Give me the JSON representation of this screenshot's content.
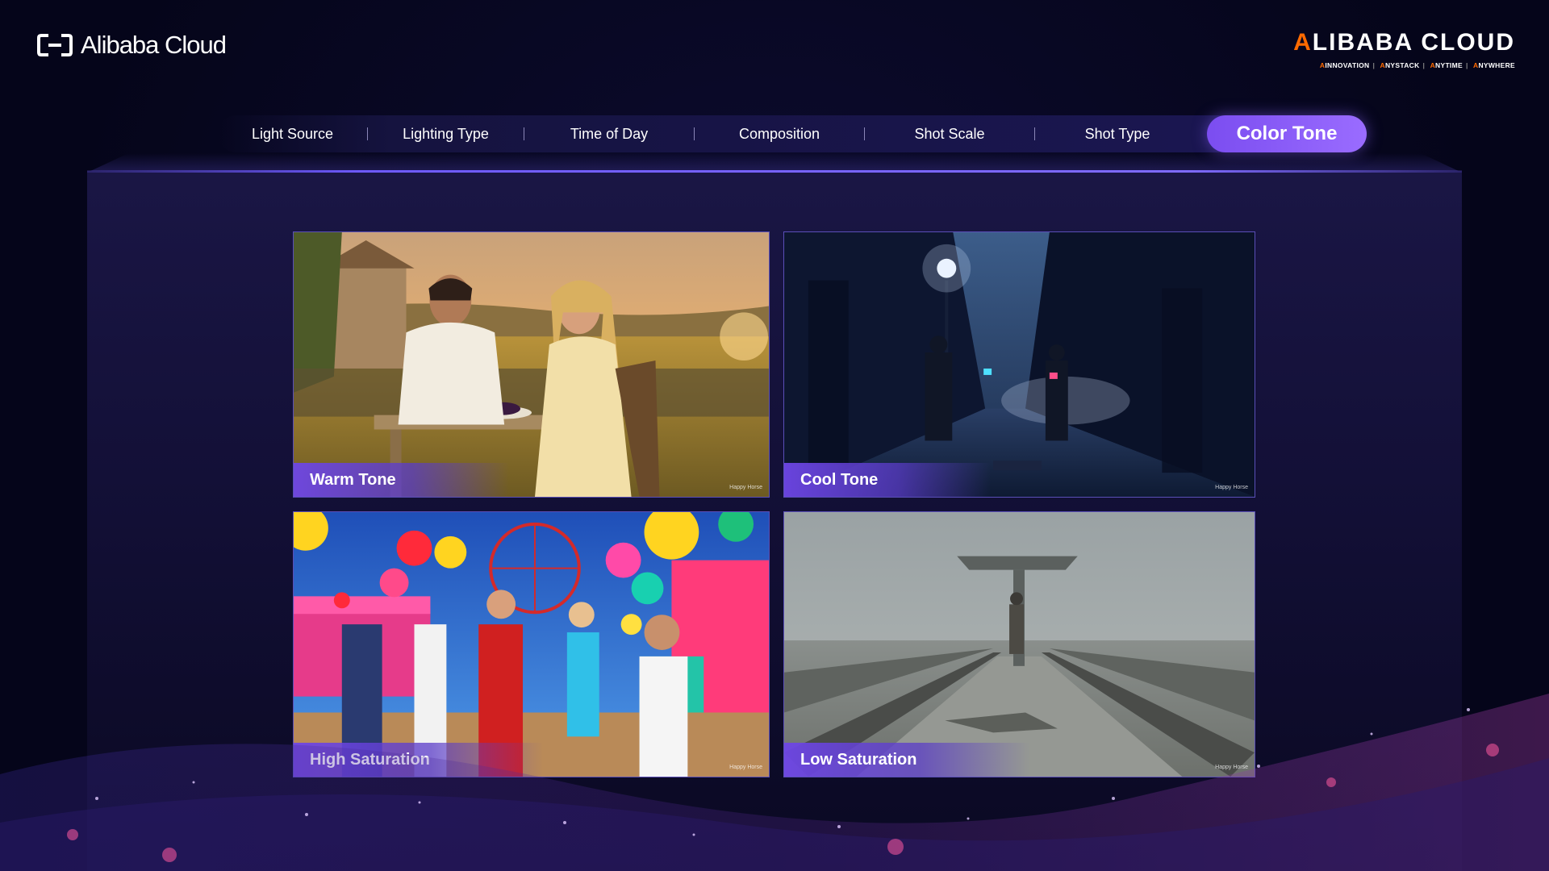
{
  "brand": {
    "left_logo": "Alibaba Cloud",
    "right_logo_accent": "A",
    "right_logo_rest": "LIBABA CLOUD",
    "right_tags": [
      "INNOVATION",
      "NYSTACK",
      "NYTIME",
      "NYWHERE"
    ],
    "right_tag_accent": "A"
  },
  "nav": {
    "items": [
      {
        "label": "Light Source"
      },
      {
        "label": "Lighting Type"
      },
      {
        "label": "Time of Day"
      },
      {
        "label": "Composition"
      },
      {
        "label": "Shot Scale"
      },
      {
        "label": "Shot Type"
      }
    ],
    "active": {
      "label": "Color Tone"
    }
  },
  "cards": [
    {
      "label": "Warm Tone",
      "watermark": "Happy Horse"
    },
    {
      "label": "Cool Tone",
      "watermark": "Happy Horse"
    },
    {
      "label": "High Saturation",
      "watermark": "Happy Horse"
    },
    {
      "label": "Low Saturation",
      "watermark": "Happy Horse"
    }
  ],
  "colors": {
    "accent_purple": "#8b5cf6",
    "brand_orange": "#ff6a00",
    "background": "#05051a"
  }
}
